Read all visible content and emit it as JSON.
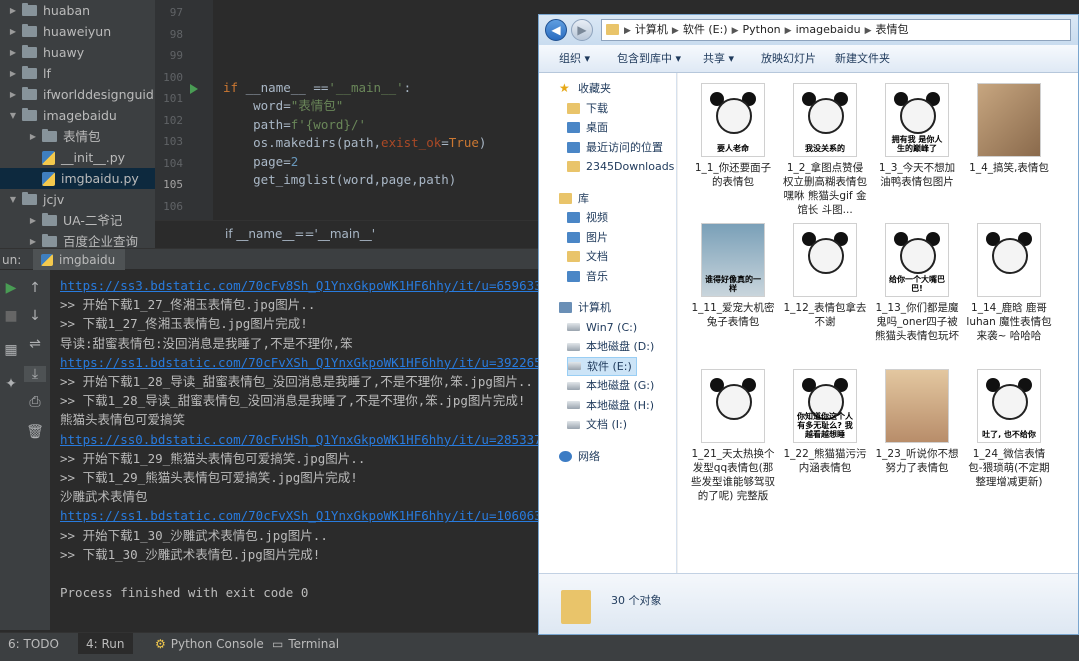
{
  "project_tree": [
    {
      "label": "huaban",
      "type": "folder",
      "indent": 0
    },
    {
      "label": "huaweiyun",
      "type": "folder",
      "indent": 0
    },
    {
      "label": "huawy",
      "type": "folder",
      "indent": 0
    },
    {
      "label": "lf",
      "type": "folder",
      "indent": 0
    },
    {
      "label": "ifworlddesignguid",
      "type": "folder",
      "indent": 0
    },
    {
      "label": "imagebaidu",
      "type": "folder-open",
      "indent": 0
    },
    {
      "label": "表情包",
      "type": "folder",
      "indent": 1
    },
    {
      "label": "__init__.py",
      "type": "py",
      "indent": 1
    },
    {
      "label": "imgbaidu.py",
      "type": "py",
      "indent": 1,
      "selected": true
    },
    {
      "label": "jcjv",
      "type": "folder-open",
      "indent": 0
    },
    {
      "label": "UA-二爷记",
      "type": "folder",
      "indent": 1
    },
    {
      "label": "百度企业查询",
      "type": "folder",
      "indent": 1
    }
  ],
  "gutter": [
    "97",
    "98",
    "99",
    "100",
    "101",
    "102",
    "103",
    "104",
    "105",
    "106"
  ],
  "code": {
    "l1_kw": "if",
    "l1_a": " __name__ ==",
    "l1_str": "'__main__'",
    "l1_b": ":",
    "l2_a": "    word=",
    "l2_str": "\"表情包\"",
    "l3_a": "    path=",
    "l3_str": "f'{word}/'",
    "l4_a": "    os.makedirs(path,",
    "l4_kw": "exist_ok",
    "l4_b": "=",
    "l4_kw2": "True",
    "l4_c": ")",
    "l5_a": "    page=",
    "l5_num": "2",
    "l6_a": "    get_imglist(word,page,path)"
  },
  "breadcrumb": "if __name__=='__main__'",
  "run_panel": {
    "label": "un:",
    "tab": "imgbaidu"
  },
  "console": [
    {
      "text": "https://ss3.bdstatic.com/70cFv8Sh_Q1YnxGkpoWK1HF6hhy/it/u=659633",
      "link": true
    },
    {
      "text": ">> 开始下载1_27_佟湘玉表情包.jpg图片..",
      "link": false
    },
    {
      "text": ">> 下载1_27_佟湘玉表情包.jpg图片完成!",
      "link": false
    },
    {
      "text": "导读:甜蜜表情包:没回消息是我睡了,不是不理你,笨",
      "link": false
    },
    {
      "text": "https://ss1.bdstatic.com/70cFvXSh_Q1YnxGkpoWK1HF6hhy/it/u=392265",
      "link": true
    },
    {
      "text": ">> 开始下载1_28_导读_甜蜜表情包_没回消息是我睡了,不是不理你,笨.jpg图片..",
      "link": false
    },
    {
      "text": ">> 下载1_28_导读_甜蜜表情包_没回消息是我睡了,不是不理你,笨.jpg图片完成!",
      "link": false
    },
    {
      "text": "熊猫头表情包可爱搞笑",
      "link": false
    },
    {
      "text": "https://ss0.bdstatic.com/70cFvHSh_Q1YnxGkpoWK1HF6hhy/it/u=285337",
      "link": true
    },
    {
      "text": ">> 开始下载1_29_熊猫头表情包可爱搞笑.jpg图片..",
      "link": false
    },
    {
      "text": ">> 下载1_29_熊猫头表情包可爱搞笑.jpg图片完成!",
      "link": false
    },
    {
      "text": "沙雕武术表情包",
      "link": false
    },
    {
      "text": "https://ss1.bdstatic.com/70cFvXSh_Q1YnxGkpoWK1HF6hhy/it/u=106063",
      "link": true
    },
    {
      "text": ">> 开始下载1_30_沙雕武术表情包.jpg图片..",
      "link": false
    },
    {
      "text": ">> 下载1_30_沙雕武术表情包.jpg图片完成!",
      "link": false
    },
    {
      "text": "",
      "link": false
    },
    {
      "text": "Process finished with exit code 0",
      "link": false
    }
  ],
  "bottom_tabs": {
    "todo": "6: TODO",
    "run": "4: Run",
    "python_console": "Python Console",
    "terminal": "Terminal"
  },
  "explorer": {
    "address": [
      "计算机",
      "软件 (E:)",
      "Python",
      "imagebaidu",
      "表情包"
    ],
    "commands": [
      "组织 ▾",
      "包含到库中 ▾",
      "共享 ▾",
      "放映幻灯片",
      "新建文件夹"
    ],
    "nav": [
      {
        "label": "收藏夹",
        "icon": "star",
        "indent": 0
      },
      {
        "label": "下载",
        "icon": "fold",
        "indent": 1
      },
      {
        "label": "桌面",
        "icon": "blue",
        "indent": 1
      },
      {
        "label": "最近访问的位置",
        "icon": "blue",
        "indent": 1
      },
      {
        "label": "2345Downloads",
        "icon": "fold",
        "indent": 1
      },
      {
        "label": "",
        "icon": "",
        "indent": 0
      },
      {
        "label": "库",
        "icon": "fold",
        "indent": 0
      },
      {
        "label": "视频",
        "icon": "blue",
        "indent": 1
      },
      {
        "label": "图片",
        "icon": "blue",
        "indent": 1
      },
      {
        "label": "文档",
        "icon": "fold",
        "indent": 1
      },
      {
        "label": "音乐",
        "icon": "blue",
        "indent": 1
      },
      {
        "label": "",
        "icon": "",
        "indent": 0
      },
      {
        "label": "计算机",
        "icon": "pc",
        "indent": 0
      },
      {
        "label": "Win7 (C:)",
        "icon": "drive",
        "indent": 1
      },
      {
        "label": "本地磁盘 (D:)",
        "icon": "drive",
        "indent": 1
      },
      {
        "label": "软件 (E:)",
        "icon": "drive",
        "indent": 1,
        "selected": true
      },
      {
        "label": "本地磁盘 (G:)",
        "icon": "drive",
        "indent": 1
      },
      {
        "label": "本地磁盘 (H:)",
        "icon": "drive",
        "indent": 1
      },
      {
        "label": "文档 (I:)",
        "icon": "drive",
        "indent": 1
      },
      {
        "label": "",
        "icon": "",
        "indent": 0
      },
      {
        "label": "网络",
        "icon": "net",
        "indent": 0
      }
    ],
    "files": [
      {
        "name": "1_1_你还要面子的表情包",
        "caption": "要人老命",
        "kind": "panda"
      },
      {
        "name": "1_2_拿图点赞侵权立删高糊表情包 嘿咻 熊猫头gif 金馆长 斗图...",
        "caption": "我没关系的",
        "kind": "panda"
      },
      {
        "name": "1_3_今天不想加油鸭表情包图片",
        "caption": "拥有我 是你人生的巅峰了",
        "kind": "panda"
      },
      {
        "name": "1_4_搞笑,表情包",
        "caption": "",
        "kind": "photo"
      },
      {
        "name": "1_11_爱宠大机密兔子表情包",
        "caption": "谁得好像真的一样",
        "kind": "rabbit"
      },
      {
        "name": "1_12_表情包拿去不谢",
        "caption": "",
        "kind": "panda"
      },
      {
        "name": "1_13_你们都是魔鬼吗_oner四子被熊猫头表情包玩坏",
        "caption": "给你一个大嘴巴巴!",
        "kind": "panda"
      },
      {
        "name": "1_14_鹿晗 鹿哥luhan 魔性表情包来袭~ 哈哈哈",
        "caption": "",
        "kind": "panda"
      },
      {
        "name": "1_21_天太热换个发型qq表情包(那些发型谁能够驾驭的了呢) 完整版",
        "caption": "",
        "kind": "panda"
      },
      {
        "name": "1_22_熊猫猫污污内涵表情包",
        "caption": "你知道你这个人有多无耻么? 我越看越想睡",
        "kind": "panda"
      },
      {
        "name": "1_23_听说你不想努力了表情包",
        "caption": "",
        "kind": "bed"
      },
      {
        "name": "1_24_微信表情包-猥琐萌(不定期整理增减更新)",
        "caption": "吐了, 也不给你",
        "kind": "panda"
      }
    ],
    "count": "30 个对象"
  }
}
